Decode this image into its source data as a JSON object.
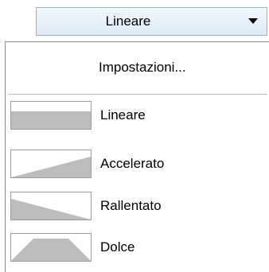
{
  "dropdown": {
    "selected_label": "Lineare",
    "arrow_icon": "chevron-down-icon"
  },
  "menu": {
    "settings_label": "Impostazioni...",
    "options": [
      {
        "label": "Lineare",
        "icon": "linear-curve-icon"
      },
      {
        "label": "Accelerato",
        "icon": "accelerated-curve-icon"
      },
      {
        "label": "Rallentato",
        "icon": "decelerated-curve-icon"
      },
      {
        "label": "Dolce",
        "icon": "smooth-curve-icon"
      }
    ]
  },
  "colors": {
    "button_border": "#8fb4d9",
    "curve_fill": "#bdbdbd",
    "swatch_border": "#9c9c9c"
  }
}
